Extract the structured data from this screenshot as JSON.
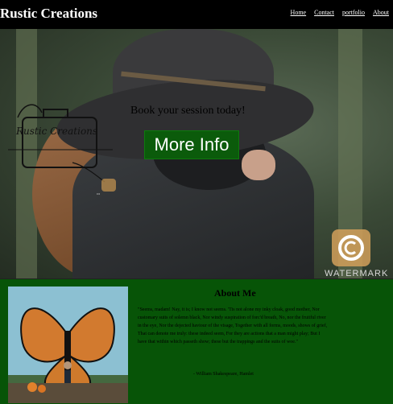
{
  "header": {
    "brand": "Rustic Creations",
    "nav": [
      "Home",
      "Contact",
      "portfolio",
      "About"
    ]
  },
  "hero": {
    "logo_text": "Rustic Creations",
    "tagline": "Book your session today!",
    "cta_label": "More Info",
    "watermark_label": "WATERMARK"
  },
  "about": {
    "title": "About Me",
    "quote": "\"Seems, madam! Nay, it is; I know not seems. 'Tis not alone my inky cloak, good mother, Nor customary suits of solemn black, Nor windy suspiration of forc'd breath, No, nor the fruitful river in the eye, Nor the dejected haviour of the visage, Together with all forms, moods, shows of grief, That can denote me truly: these indeed seem, For they are actions that a man might play; But I have that within which passeth show; these but the trappings and the suits of woe.\"",
    "attribution": "- William Shakespeare, Hamlet"
  }
}
